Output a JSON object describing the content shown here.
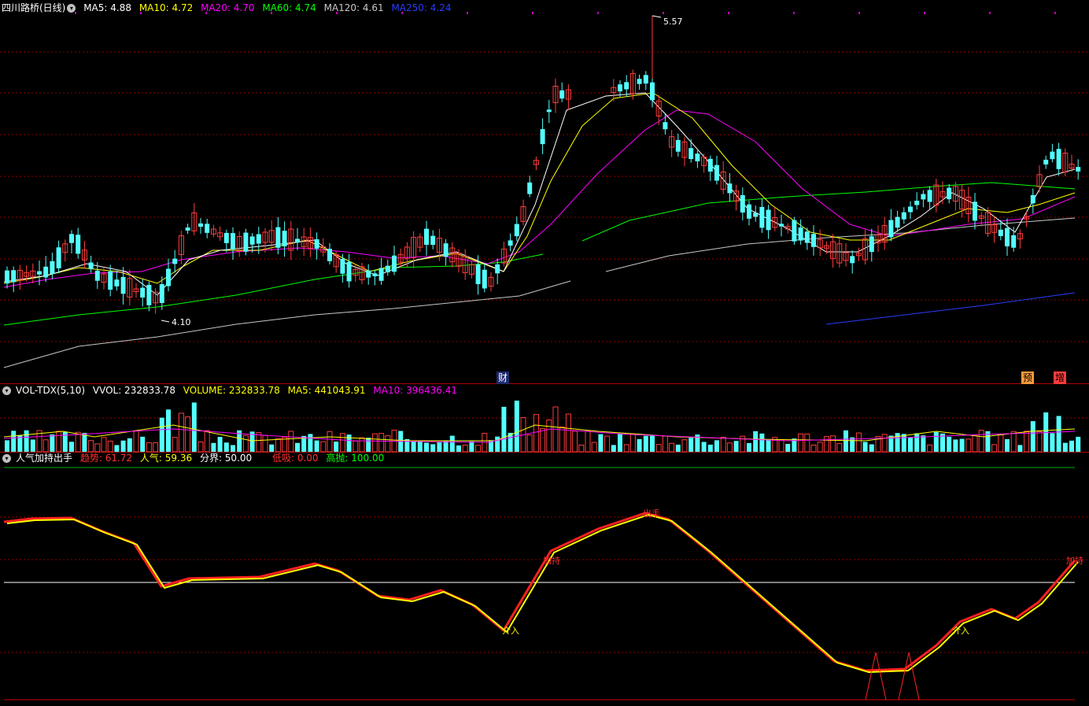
{
  "main": {
    "title": "四川路桥(日线)",
    "ma5": "MA5: 4.88",
    "ma10": "MA10: 4.72",
    "ma20": "MA20: 4.70",
    "ma60": "MA60: 4.74",
    "ma120": "MA120: 4.61",
    "ma250": "MA250: 4.24",
    "high_label": "5.57",
    "low_label": "4.10",
    "marker_cai": "财",
    "marker_yu": "预",
    "marker_zeng": "增"
  },
  "volume": {
    "title": "VOL-TDX(5,10)",
    "vvol": "VVOL: 232833.78",
    "volume": "VOLUME: 232833.78",
    "ma5": "MA5: 441043.91",
    "ma10": "MA10: 396436.41"
  },
  "indicator": {
    "title": "人气加持出手",
    "trend": "趋势: 61.72",
    "popularity": "人气: 59.36",
    "boundary": "分界: 50.00",
    "low_buy": "低吸: 0.00",
    "high_sell": "高抛: 100.00",
    "sig_jiechi_1": "加持",
    "sig_chushou": "出手",
    "sig_jieru_1": "介入",
    "sig_jieru_2": "介入",
    "sig_jiechi_2": "加持"
  },
  "colors": {
    "up": "#ff3c3c",
    "down": "#54ffff",
    "ma5": "#ffffff",
    "ma10": "#ffff00",
    "ma20": "#ff00ff",
    "ma60": "#00ff00",
    "ma120": "#c8c8c8",
    "ma250": "#2a3cff",
    "grid": "#8b0000"
  }
}
